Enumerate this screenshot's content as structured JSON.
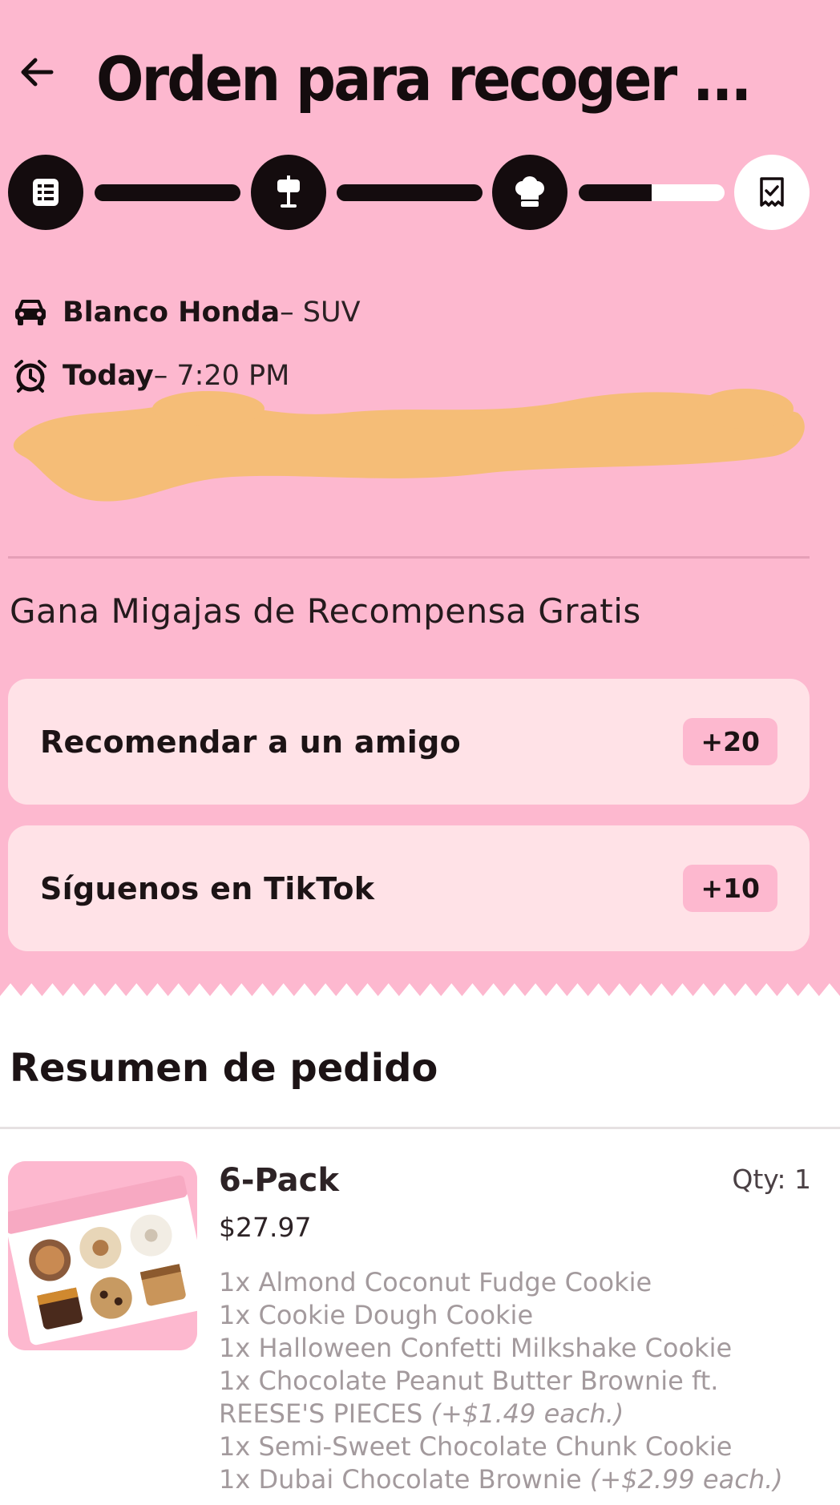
{
  "header": {
    "title": "Orden para recoger ..."
  },
  "progress": {
    "steps": [
      {
        "icon": "checklist-icon",
        "status": "complete"
      },
      {
        "icon": "signpost-icon",
        "status": "complete"
      },
      {
        "icon": "chef-hat-icon",
        "status": "complete"
      },
      {
        "icon": "receipt-check-icon",
        "status": "pending"
      }
    ],
    "third_segment_fill": 0.5
  },
  "pickup": {
    "vehicle_strong": "Blanco Honda",
    "vehicle_rest": " – SUV",
    "time_strong": "Today",
    "time_rest": " – 7:20 PM"
  },
  "rewards": {
    "title": "Gana Migajas de Recompensa Gratis",
    "items": [
      {
        "label": "Recomendar a un amigo",
        "points": "+20"
      },
      {
        "label": "Síguenos en TikTok",
        "points": "+10"
      }
    ]
  },
  "summary": {
    "title": "Resumen de pedido",
    "product": {
      "name": "6-Pack",
      "price": "$27.97",
      "qty": "Qty: 1",
      "items": [
        {
          "text": "1x Almond Coconut Fudge Cookie",
          "extra": ""
        },
        {
          "text": "1x Cookie Dough Cookie",
          "extra": ""
        },
        {
          "text": "1x Halloween Confetti Milkshake Cookie",
          "extra": ""
        },
        {
          "text": "1x Chocolate Peanut Butter Brownie ft. REESE'S PIECES ",
          "extra": "(+$1.49 each.)"
        },
        {
          "text": "1x Semi-Sweet Chocolate Chunk Cookie",
          "extra": ""
        },
        {
          "text": "1x Dubai Chocolate Brownie ",
          "extra": "(+$2.99 each.)"
        }
      ]
    }
  },
  "colors": {
    "pink_background": "#fdb8cf",
    "card_background": "#ffe2e7",
    "dark": "#140c0e",
    "redaction": "#f5bd77"
  }
}
